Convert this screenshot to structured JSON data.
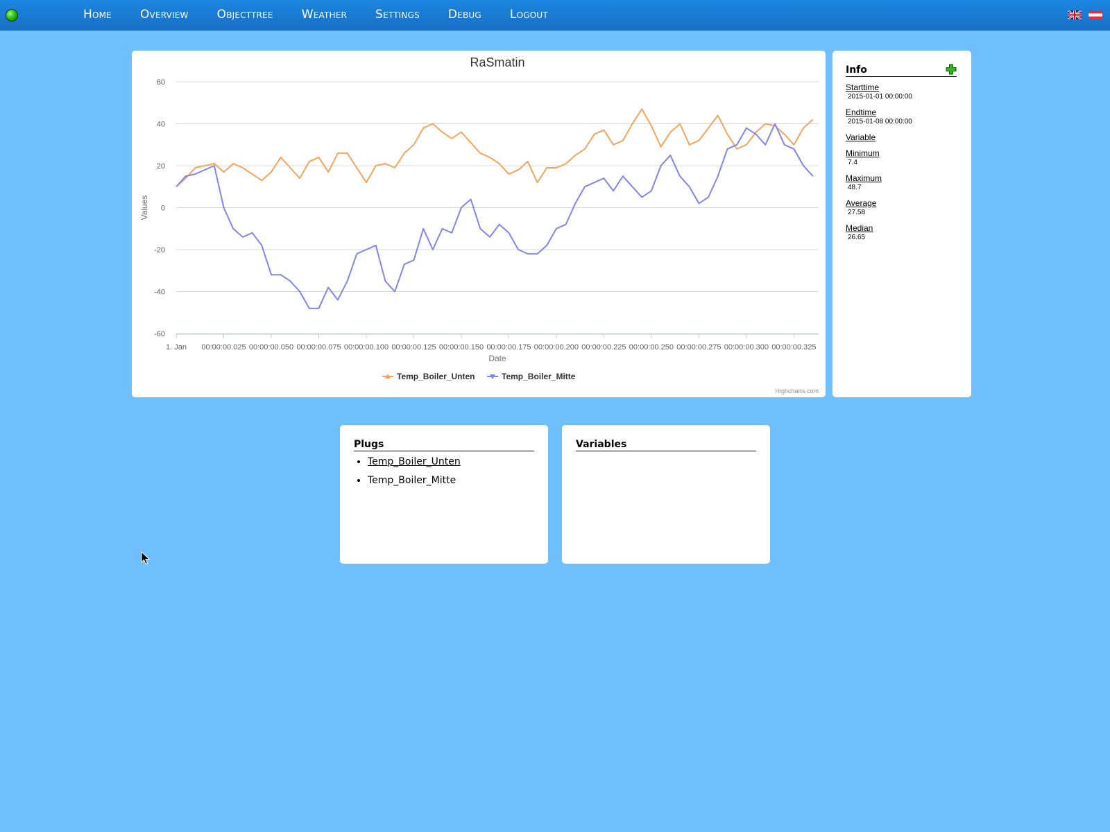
{
  "nav": {
    "items": [
      "Home",
      "Overview",
      "Objecttree",
      "Weather",
      "Settings",
      "Debug",
      "Logout"
    ]
  },
  "flags": {
    "english": "flag-uk-icon",
    "german": "flag-at-icon"
  },
  "info": {
    "heading": "Info",
    "entries": [
      {
        "label": "Starttime",
        "value": "2015-01-01 00:00:00"
      },
      {
        "label": "Endtime",
        "value": "2015-01-08 00:00:00"
      },
      {
        "label": "Variable",
        "value": ""
      },
      {
        "label": "Minimum",
        "value": "7.4"
      },
      {
        "label": "Maximum",
        "value": "48.7"
      },
      {
        "label": "Average",
        "value": "27.58"
      },
      {
        "label": "Median",
        "value": "26.65"
      }
    ]
  },
  "plugs": {
    "heading": "Plugs",
    "items": [
      "Temp_Boiler_Unten",
      "Temp_Boiler_Mitte"
    ]
  },
  "variables": {
    "heading": "Variables"
  },
  "colors": {
    "background": "#6fbffd",
    "series1": "#f7a35c",
    "series2": "#8085e9",
    "nav": "#1c86e0"
  },
  "chart_data": {
    "type": "line",
    "title": "RaSmatin",
    "xlabel": "Date",
    "ylabel": "Values",
    "credits": "Highcharts.com",
    "ylim": [
      -60,
      60
    ],
    "yticks": [
      -60,
      -40,
      -20,
      0,
      20,
      40,
      60
    ],
    "xlim": [
      0,
      0.338
    ],
    "xticks": [
      0,
      0.025,
      0.05,
      0.075,
      0.1,
      0.125,
      0.15,
      0.175,
      0.2,
      0.225,
      0.25,
      0.275,
      0.3,
      0.325
    ],
    "xtick_labels": [
      "1. Jan",
      "00:00:00.025",
      "00:00:00.050",
      "00:00:00.075",
      "00:00:00.100",
      "00:00:00.125",
      "00:00:00.150",
      "00:00:00.175",
      "00:00:00.200",
      "00:00:00.225",
      "00:00:00.250",
      "00:00:00.275",
      "00:00:00.300",
      "00:00:00.325"
    ],
    "grid": true,
    "legend": "bottom-center",
    "series": [
      {
        "name": "Temp_Boiler_Unten",
        "color": "#f7a35c",
        "x": [
          0,
          0.005,
          0.01,
          0.015,
          0.02,
          0.025,
          0.03,
          0.035,
          0.04,
          0.045,
          0.05,
          0.055,
          0.06,
          0.065,
          0.07,
          0.075,
          0.08,
          0.085,
          0.09,
          0.095,
          0.1,
          0.105,
          0.11,
          0.115,
          0.12,
          0.125,
          0.13,
          0.135,
          0.14,
          0.145,
          0.15,
          0.155,
          0.16,
          0.165,
          0.17,
          0.175,
          0.18,
          0.185,
          0.19,
          0.195,
          0.2,
          0.205,
          0.21,
          0.215,
          0.22,
          0.225,
          0.23,
          0.235,
          0.24,
          0.245,
          0.25,
          0.255,
          0.26,
          0.265,
          0.27,
          0.275,
          0.28,
          0.285,
          0.29,
          0.295,
          0.3,
          0.305,
          0.31,
          0.315,
          0.32,
          0.325,
          0.33,
          0.335
        ],
        "y": [
          10,
          14,
          19,
          20,
          21,
          17,
          21,
          19,
          16,
          13,
          17,
          24,
          19,
          14,
          22,
          24,
          17,
          26,
          26,
          19,
          12,
          20,
          21,
          19,
          26,
          30,
          38,
          40,
          36,
          33,
          36,
          31,
          26,
          24,
          21,
          16,
          18,
          22,
          12,
          19,
          19,
          21,
          25,
          28,
          35,
          37,
          30,
          32,
          40,
          47,
          39,
          29,
          36,
          40,
          30,
          32,
          38,
          44,
          35,
          28,
          30,
          36,
          40,
          39,
          35,
          30,
          38,
          42
        ]
      },
      {
        "name": "Temp_Boiler_Mitte",
        "color": "#8085e9",
        "x": [
          0,
          0.005,
          0.01,
          0.015,
          0.02,
          0.025,
          0.03,
          0.035,
          0.04,
          0.045,
          0.05,
          0.055,
          0.06,
          0.065,
          0.07,
          0.075,
          0.08,
          0.085,
          0.09,
          0.095,
          0.1,
          0.105,
          0.11,
          0.115,
          0.12,
          0.125,
          0.13,
          0.135,
          0.14,
          0.145,
          0.15,
          0.155,
          0.16,
          0.165,
          0.17,
          0.175,
          0.18,
          0.185,
          0.19,
          0.195,
          0.2,
          0.205,
          0.21,
          0.215,
          0.22,
          0.225,
          0.23,
          0.235,
          0.24,
          0.245,
          0.25,
          0.255,
          0.26,
          0.265,
          0.27,
          0.275,
          0.28,
          0.285,
          0.29,
          0.295,
          0.3,
          0.305,
          0.31,
          0.315,
          0.32,
          0.325,
          0.33,
          0.335
        ],
        "y": [
          10,
          15,
          16,
          18,
          20,
          0,
          -10,
          -14,
          -12,
          -18,
          -32,
          -32,
          -35,
          -40,
          -48,
          -48,
          -38,
          -44,
          -35,
          -22,
          -20,
          -18,
          -35,
          -40,
          -27,
          -25,
          -10,
          -20,
          -10,
          -12,
          0,
          4,
          -10,
          -14,
          -8,
          -12,
          -20,
          -22,
          -22,
          -18,
          -10,
          -8,
          2,
          10,
          12,
          14,
          8,
          15,
          10,
          5,
          8,
          20,
          25,
          15,
          10,
          2,
          5,
          15,
          28,
          30,
          38,
          35,
          30,
          40,
          30,
          28,
          20,
          15
        ]
      }
    ]
  }
}
